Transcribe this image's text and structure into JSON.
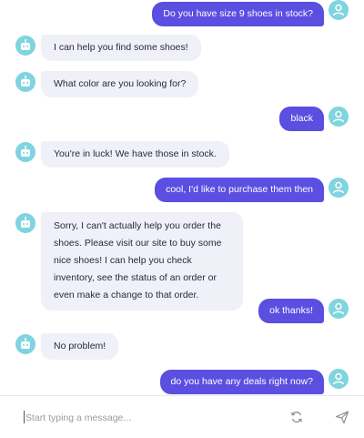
{
  "messages": [
    {
      "from": "user",
      "text": "Do you have size 9 shoes in stock?"
    },
    {
      "from": "bot",
      "text": "I can help you find some shoes!"
    },
    {
      "from": "bot",
      "text": "What color are you looking for?"
    },
    {
      "from": "user",
      "text": "black"
    },
    {
      "from": "bot",
      "text": "You're in luck! We have those in stock."
    },
    {
      "from": "user",
      "text": "cool, I'd like to purchase them then"
    },
    {
      "from": "bot",
      "text": "Sorry, I can't actually help you order the shoes. Please visit our site to buy some nice shoes! I can help you check inventory, see the status of an order or even make a change to that order."
    },
    {
      "from": "user",
      "text": "ok thanks!"
    },
    {
      "from": "bot",
      "text": "No problem!"
    },
    {
      "from": "user",
      "text": "do you have any deals right now?"
    }
  ],
  "composer": {
    "placeholder": "Start typing a message...",
    "value": ""
  },
  "icons": {
    "bot_avatar": "robot-icon",
    "user_avatar": "user-icon",
    "refresh": "refresh-icon",
    "send": "send-icon"
  },
  "colors": {
    "user_bubble": "#5a4fe0",
    "bot_bubble": "#f0f0f8",
    "avatar": "#7fd4df"
  }
}
